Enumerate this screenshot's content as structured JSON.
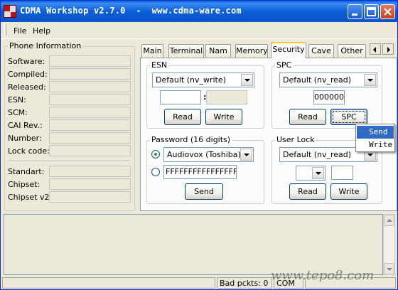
{
  "window": {
    "title": "CDMA Workshop v2.7.0  -  www.cdma-ware.com",
    "app_icon": "cdma-workshop-logo",
    "controls": [
      "minimize-icon",
      "maximize-icon",
      "close-icon"
    ]
  },
  "menu": {
    "items": [
      "File",
      "Help"
    ]
  },
  "phone_info": {
    "title": "Phone Information",
    "fields": [
      "Software:",
      "Compiled:",
      "Released:",
      "ESN:",
      "SCM:",
      "CAI Rev.:",
      "Number:",
      "Lock code:"
    ],
    "fields2": [
      "Standart:",
      "Chipset:",
      "Chipset v2:"
    ]
  },
  "tabs": {
    "items": [
      "Main",
      "Terminal",
      "Nam",
      "Memory",
      "Security",
      "Cave",
      "Other"
    ],
    "active": "Security"
  },
  "esn": {
    "title": "ESN",
    "mode": "Default (nv_write)",
    "separator": ":",
    "read_label": "Read",
    "write_label": "Write"
  },
  "spc": {
    "title": "SPC",
    "mode": "Default (nv_read)",
    "code": "000000",
    "read_label": "Read",
    "spc_label": "SPC"
  },
  "password": {
    "title": "Password (16 digits)",
    "option1": "Audiovox (Toshiba)",
    "option2": "FFFFFFFFFFFFFFFF",
    "selected": "option1",
    "send_label": "Send"
  },
  "user_lock": {
    "title": "User Lock",
    "mode": "Default (nv_read)",
    "read_label": "Read",
    "write_label": "Write"
  },
  "context_menu": {
    "items": [
      "Send",
      "Write"
    ],
    "highlighted": "Send"
  },
  "status": {
    "bad_packets": "Bad pckts: 0",
    "port": "COM"
  },
  "watermark": "www.tepo8.com"
}
